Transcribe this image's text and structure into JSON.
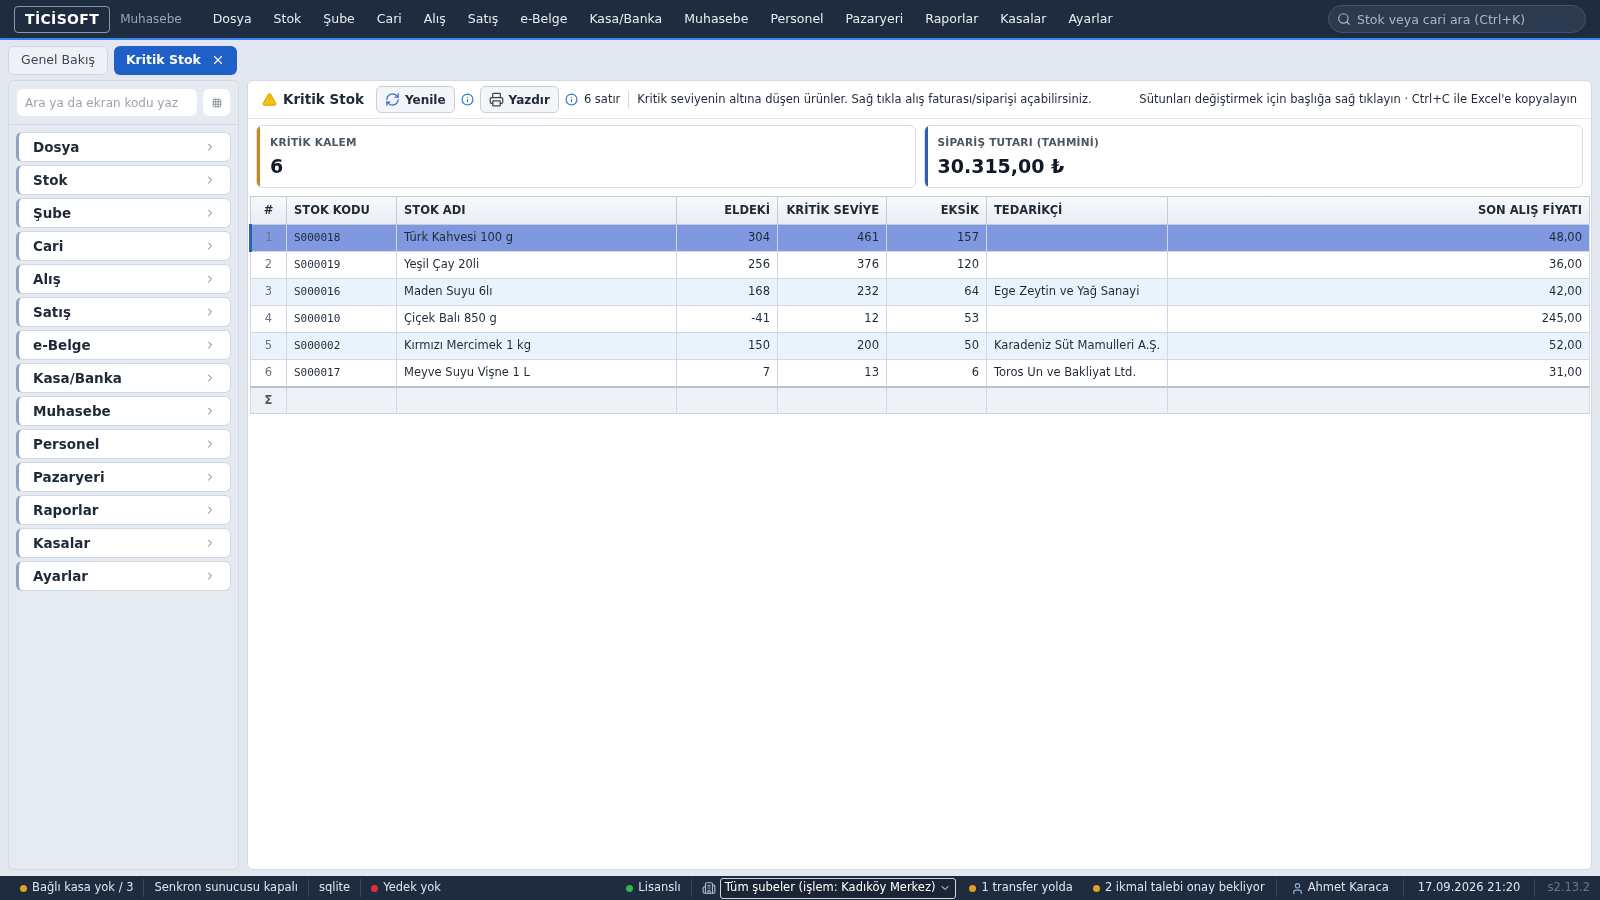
{
  "app": {
    "logo": "TİCİSOFT",
    "module": "Muhasebe"
  },
  "menu": [
    "Dosya",
    "Stok",
    "Şube",
    "Cari",
    "Alış",
    "Satış",
    "e-Belge",
    "Kasa/Banka",
    "Muhasebe",
    "Personel",
    "Pazaryeri",
    "Raporlar",
    "Kasalar",
    "Ayarlar"
  ],
  "search": {
    "placeholder": "Stok veya cari ara (Ctrl+K)"
  },
  "tabs": [
    {
      "label": "Genel Bakış",
      "selected": false,
      "closable": false
    },
    {
      "label": "Kritik Stok",
      "selected": true,
      "closable": true
    }
  ],
  "sidebar": {
    "search_placeholder": "Ara ya da ekran kodu yaz",
    "items": [
      "Dosya",
      "Stok",
      "Şube",
      "Cari",
      "Alış",
      "Satış",
      "e-Belge",
      "Kasa/Banka",
      "Muhasebe",
      "Personel",
      "Pazaryeri",
      "Raporlar",
      "Kasalar",
      "Ayarlar"
    ]
  },
  "toolbar": {
    "title": "Kritik Stok",
    "refresh": "Yenile",
    "print": "Yazdır",
    "row_count": "6 satır",
    "info": "Kritik seviyenin altına düşen ürünler. Sağ tıkla alış faturası/siparişi açabilirsiniz.",
    "hint": "Sütunları değiştirmek için başlığa sağ tıklayın · Ctrl+C ile Excel'e kopyalayın"
  },
  "cards": [
    {
      "label": "KRİTİK KALEM",
      "value": "6",
      "color": "#c9891a"
    },
    {
      "label": "SİPARİŞ TUTARI (TAHMİNİ)",
      "value": "30.315,00 ₺",
      "color": "#2f5fb3"
    }
  ],
  "table": {
    "columns": [
      "#",
      "STOK KODU",
      "STOK ADI",
      "ELDEKİ",
      "KRİTİK SEVİYE",
      "EKSİK",
      "TEDARİKÇİ",
      "SON ALIŞ FİYATI"
    ],
    "rows": [
      {
        "cells": [
          "1",
          "S000018",
          "Türk Kahvesi 100 g",
          "304",
          "461",
          "157",
          "",
          "48,00"
        ],
        "selected": true
      },
      {
        "cells": [
          "2",
          "S000019",
          "Yeşil Çay 20li",
          "256",
          "376",
          "120",
          "",
          "36,00"
        ],
        "selected": false
      },
      {
        "cells": [
          "3",
          "S000016",
          "Maden Suyu 6lı",
          "168",
          "232",
          "64",
          "Ege Zeytin ve Yağ Sanayi",
          "42,00"
        ],
        "selected": false
      },
      {
        "cells": [
          "4",
          "S000010",
          "Çiçek Balı 850 g",
          "-41",
          "12",
          "53",
          "",
          "245,00"
        ],
        "selected": false
      },
      {
        "cells": [
          "5",
          "S000002",
          "Kırmızı Mercimek 1 kg",
          "150",
          "200",
          "50",
          "Karadeniz Süt Mamulleri A.Ş.",
          "52,00"
        ],
        "selected": false
      },
      {
        "cells": [
          "6",
          "S000017",
          "Meyve Suyu Vişne 1 L",
          "7",
          "13",
          "6",
          "Toros Un ve Bakliyat Ltd.",
          "31,00"
        ],
        "selected": false
      }
    ],
    "footer": "Σ"
  },
  "status_bar": {
    "left": [
      {
        "text": "Bağlı kasa yok / 3",
        "color": "#e0a020"
      },
      {
        "text": "Senkron sunucusu kapalı"
      },
      {
        "text": "sqlite"
      },
      {
        "text": "Yedek yok",
        "color": "#e03030"
      }
    ],
    "license": {
      "text": "Lisanslı",
      "color": "#2eb84a"
    },
    "branch": "Tüm şubeler (işlem: Kadıköy Merkez)",
    "right": [
      {
        "text": "1 transfer yolda",
        "color": "#e0a020"
      },
      {
        "text": "2 ikmal talebi onay bekliyor",
        "color": "#e0a020"
      }
    ],
    "user": "Ahmet Karaca",
    "datetime": "17.09.2026 21:20",
    "version": "s2.13.2"
  }
}
